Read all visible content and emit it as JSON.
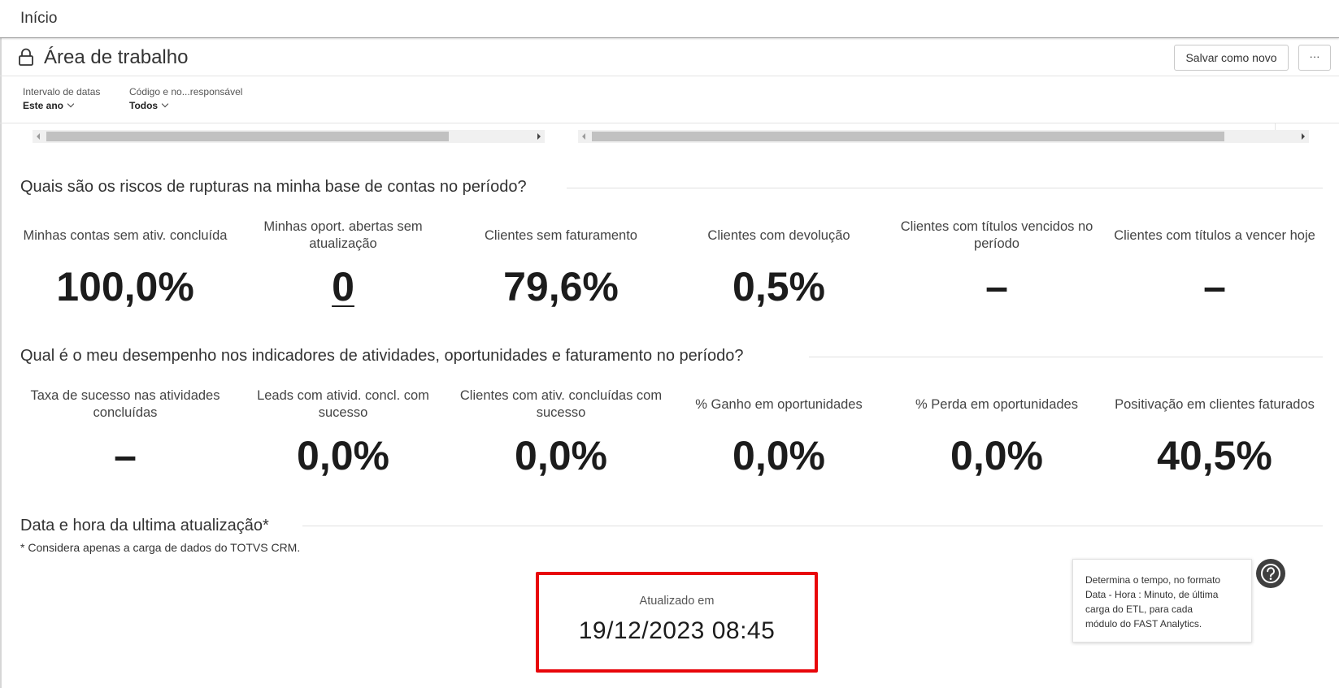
{
  "topbar": {
    "home_label": "Início"
  },
  "workspace": {
    "title": "Área de trabalho",
    "save_label": "Salvar como novo",
    "more_label": "···"
  },
  "filters": [
    {
      "label": "Intervalo de datas",
      "value": "Este ano"
    },
    {
      "label": "Código e no...responsável",
      "value": "Todos"
    }
  ],
  "section1": {
    "title": "Quais são os riscos de rupturas na minha base de contas no período?",
    "kpis": [
      {
        "label": "Minhas contas sem ativ. concluída",
        "value": "100,0%"
      },
      {
        "label": "Minhas oport. abertas sem atualização",
        "value": "0"
      },
      {
        "label": "Clientes sem faturamento",
        "value": "79,6%"
      },
      {
        "label": "Clientes com devolução",
        "value": "0,5%"
      },
      {
        "label": "Clientes com títulos vencidos no período",
        "value": "–"
      },
      {
        "label": "Clientes com títulos a vencer hoje",
        "value": "–"
      }
    ]
  },
  "section2": {
    "title": "Qual é o meu desempenho nos indicadores de atividades, oportunidades e faturamento no período?",
    "kpis": [
      {
        "label": "Taxa de sucesso nas atividades concluídas",
        "value": "–"
      },
      {
        "label": "Leads com ativid. concl. com sucesso",
        "value": "0,0%"
      },
      {
        "label": "Clientes com ativ. concluídas com sucesso",
        "value": "0,0%"
      },
      {
        "label": "% Ganho em oportunidades",
        "value": "0,0%"
      },
      {
        "label": "% Perda em oportunidades",
        "value": "0,0%"
      },
      {
        "label": "Positivação em clientes faturados",
        "value": "40,5%"
      }
    ]
  },
  "section3": {
    "title": "Data e hora da ultima atualização*",
    "note": "* Considera apenas a carga de dados do TOTVS CRM.",
    "updated_label": "Atualizado em",
    "updated_value": "19/12/2023 08:45"
  },
  "tooltip": {
    "lines": [
      "Determina o tempo, no formato",
      "Data - Hora : Minuto, de última",
      "carga do ETL, para cada",
      "módulo do FAST Analytics."
    ]
  },
  "icons": {
    "lock": "lock-icon",
    "help": "help-icon",
    "chevron": "chevron-down-icon"
  },
  "colors": {
    "highlight_border": "#e8060a",
    "help_button": "#3f3f3f"
  }
}
